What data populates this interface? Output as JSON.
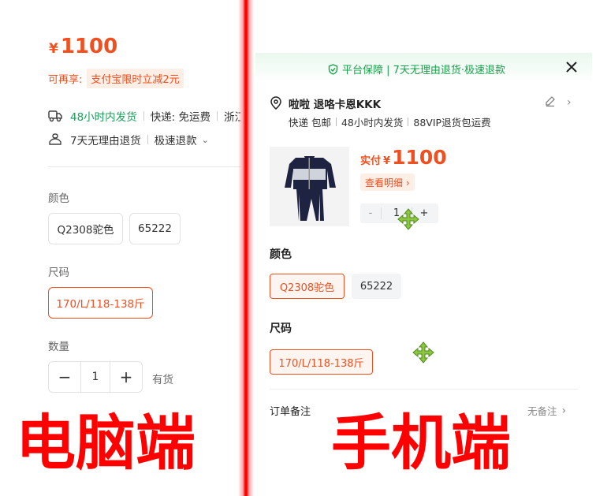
{
  "desktop": {
    "price": {
      "currency": "¥",
      "amount": "1100"
    },
    "promo": {
      "label": "可再享:",
      "tag": "支付宝限时立减2元"
    },
    "shipping": {
      "speed": "48小时内发货",
      "fee": "快递: 免运费",
      "origin": "浙江"
    },
    "returns": {
      "policy": "7天无理由退货",
      "refund": "极速退款"
    },
    "color": {
      "label": "颜色",
      "options": [
        "Q2308驼色",
        "65222"
      ]
    },
    "size": {
      "label": "尺码",
      "options": [
        "170/L/118-138斤"
      ]
    },
    "quantity": {
      "label": "数量",
      "minus": "−",
      "value": "1",
      "plus": "+",
      "stock": "有货"
    }
  },
  "mobile": {
    "banner": "平台保障 | 7天无理由退货·极速退款",
    "address": {
      "name": "啦啦 退咯卡恩KKK",
      "tags": [
        "快递 包邮",
        "48小时内发货",
        "88VIP退货包运费"
      ]
    },
    "price": {
      "prefix": "实付",
      "currency": "¥",
      "amount": "1100"
    },
    "detail_link": "查看明细 ›",
    "quantity": {
      "minus": "-",
      "value": "1",
      "plus": "+"
    },
    "color": {
      "label": "颜色",
      "options": [
        "Q2308驼色",
        "65222"
      ]
    },
    "size": {
      "label": "尺码",
      "options": [
        "170/L/118-138斤"
      ]
    },
    "note": {
      "label": "订单备注",
      "value": "无备注"
    }
  },
  "captions": {
    "left": "电脑端",
    "right": "手机端"
  },
  "colors": {
    "accent": "#f04f1f",
    "green": "#16a34a",
    "caption": "#ff0000",
    "divider": "#ff0000"
  },
  "icons": [
    "truck-icon",
    "return-icon",
    "shield-check-icon",
    "close-icon",
    "location-pin-icon",
    "edit-icon",
    "chevron-right-icon",
    "move-cursor-icon"
  ]
}
